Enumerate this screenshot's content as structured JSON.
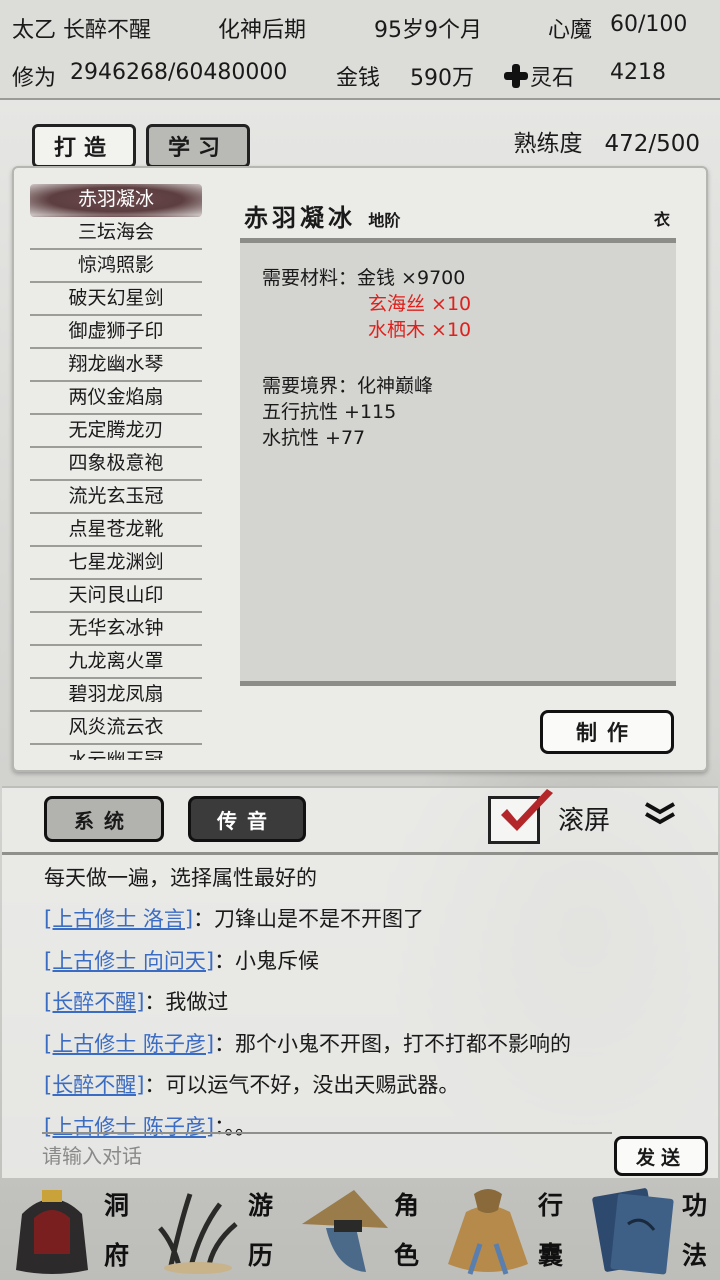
{
  "status": {
    "name": "太乙 长醉不醒",
    "realm": "化神后期",
    "age": "95岁9个月",
    "heart_demon_label": "心魔",
    "heart_demon_value": "60/100",
    "cultivation_label": "修为",
    "cultivation_value": "2946268/60480000",
    "money_label": "金钱",
    "money_value": "590万",
    "spirit_stone_label": "灵石",
    "spirit_stone_value": "4218"
  },
  "tabs": [
    {
      "label": "打造",
      "active": true
    },
    {
      "label": "学习",
      "active": false
    }
  ],
  "mastery": {
    "label": "熟练度",
    "value": "472/500"
  },
  "recipes": [
    "赤羽凝冰",
    "三坛海会",
    "惊鸿照影",
    "破天幻星剑",
    "御虚狮子印",
    "翔龙幽水琴",
    "两仪金焰扇",
    "无定腾龙刃",
    "四象极意袍",
    "流光玄玉冠",
    "点星苍龙靴",
    "七星龙渊剑",
    "天问艮山印",
    "无华玄冰钟",
    "九龙离火罩",
    "碧羽龙凤扇",
    "风炎流云衣",
    "水云幽玉冠"
  ],
  "selected_index": 0,
  "detail": {
    "name": "赤羽凝冰",
    "grade": "地阶",
    "type": "衣",
    "materials_label": "需要材料：",
    "material_money": "金钱 ×9700",
    "material_1": "玄海丝 ×10",
    "material_2": "水栖木 ×10",
    "realm_required": "需要境界：化神巅峰",
    "stat_1": "五行抗性 +115",
    "stat_2": "水抗性 +77"
  },
  "make_button": "制作",
  "chat": {
    "system_button": "系统",
    "voice_button": "传音",
    "scroll_label": "滚屏",
    "scroll_checked": true,
    "messages": [
      {
        "sender": "",
        "text": "每天做一遍，选择属性最好的"
      },
      {
        "sender": "[上古修士 洛言]",
        "text": "：刀锋山是不是不开图了"
      },
      {
        "sender": "[上古修士 向问天]",
        "text": "：小鬼斥候"
      },
      {
        "sender": "[长醉不醒]",
        "text": "：我做过"
      },
      {
        "sender": "[上古修士 陈子彦]",
        "text": "：那个小鬼不开图，打不打都不影响的"
      },
      {
        "sender": "[长醉不醒]",
        "text": "：可以运气不好，没出天赐武器。"
      },
      {
        "sender": "[上古修士 陈子彦]",
        "text": "：。。"
      }
    ],
    "input_placeholder": "请输入对话",
    "send_button": "发送"
  },
  "nav": [
    {
      "top": "洞",
      "bottom": "府",
      "icon": "cave-residence-icon"
    },
    {
      "top": "游",
      "bottom": "历",
      "icon": "travel-icon"
    },
    {
      "top": "角",
      "bottom": "色",
      "icon": "character-icon"
    },
    {
      "top": "行",
      "bottom": "囊",
      "icon": "bag-icon"
    },
    {
      "top": "功",
      "bottom": "法",
      "icon": "technique-book-icon"
    }
  ],
  "colors": {
    "link": "#3b6cc4",
    "missing_material": "#e0201c",
    "selected_item": "#5d3e40"
  }
}
